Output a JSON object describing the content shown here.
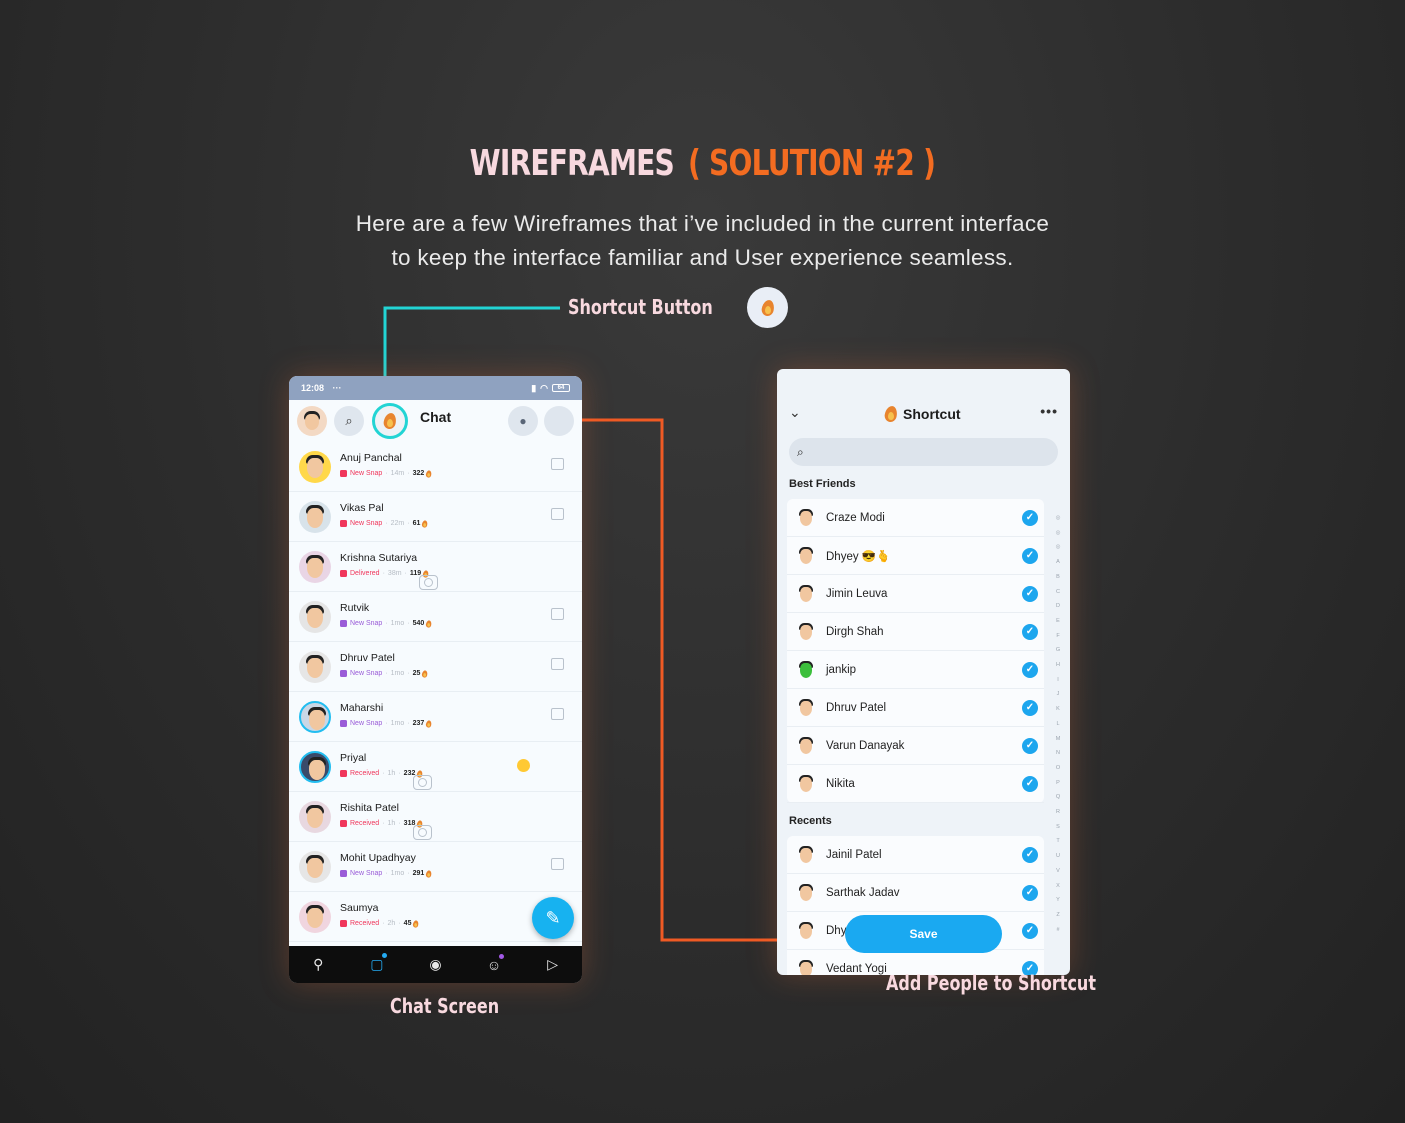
{
  "heading": {
    "title_main": "WIREFRAMES",
    "title_accent": "( SOLUTION #2 )"
  },
  "subtitle": {
    "line1": "Here are a few Wireframes that i’ve included in the current interface",
    "line2": "to keep the interface familiar and User experience seamless."
  },
  "callout": {
    "label": "Shortcut Button",
    "line_color": "#22d4d4",
    "connector_color": "#ef5a24"
  },
  "phone_chat": {
    "status_time": "12:08",
    "status_dots": "···",
    "battery": "64",
    "title": "Chat",
    "caption": "Chat Screen",
    "rows": [
      {
        "name": "Anuj Panchal",
        "status": "New Snap",
        "status_color": "#f0365b",
        "time": "14m",
        "streak": "322",
        "icon": "chat-icon"
      },
      {
        "name": "Vikas Pal",
        "status": "New Snap",
        "status_color": "#f0365b",
        "time": "22m",
        "streak": "61",
        "icon": "chat-icon"
      },
      {
        "name": "Krishna Sutariya",
        "status": "Delivered",
        "status_color": "#f0365b",
        "time": "38m",
        "streak": "119",
        "icon": "camera-icon"
      },
      {
        "name": "Rutvik",
        "status": "New Snap",
        "status_color": "#9a5cd8",
        "time": "1mo",
        "streak": "540",
        "icon": "chat-icon"
      },
      {
        "name": "Dhruv Patel",
        "status": "New Snap",
        "status_color": "#9a5cd8",
        "time": "1mo",
        "streak": "25",
        "icon": "chat-icon"
      },
      {
        "name": "Maharshi",
        "status": "New Snap",
        "status_color": "#9a5cd8",
        "time": "1mo",
        "streak": "237",
        "icon": "chat-icon"
      },
      {
        "name": "Priyal",
        "status": "Received",
        "status_color": "#f0365b",
        "time": "1h",
        "streak": "232",
        "icon": "camera-icon"
      },
      {
        "name": "Rishita Patel",
        "status": "Received",
        "status_color": "#f0365b",
        "time": "1h",
        "streak": "318",
        "icon": "camera-icon"
      },
      {
        "name": "Mohit Upadhyay",
        "status": "New Snap",
        "status_color": "#9a5cd8",
        "time": "1mo",
        "streak": "291",
        "icon": "chat-icon"
      },
      {
        "name": "Saumya",
        "status": "Received",
        "status_color": "#f0365b",
        "time": "2h",
        "streak": "45",
        "icon": "none"
      }
    ]
  },
  "phone_shortcut": {
    "title": "Shortcut",
    "caption": "Add People to Shortcut",
    "best_friends_label": "Best Friends",
    "recents_label": "Recents",
    "best_friends": [
      "Craze Modi",
      "Dhyey 😎🫰",
      "Jimin Leuva",
      "Dirgh Shah",
      "jankip",
      "Dhruv Patel",
      "Varun Danayak",
      "Nikita"
    ],
    "recents": [
      "Jainil Patel",
      "Sarthak Jadav",
      "Dhy",
      "Vedant Yogi"
    ],
    "save_label": "Save",
    "alphabet": "◎ ◎ ◎ A B C D E F G H I J K L M N O P Q R S T U V X Y Z #"
  }
}
